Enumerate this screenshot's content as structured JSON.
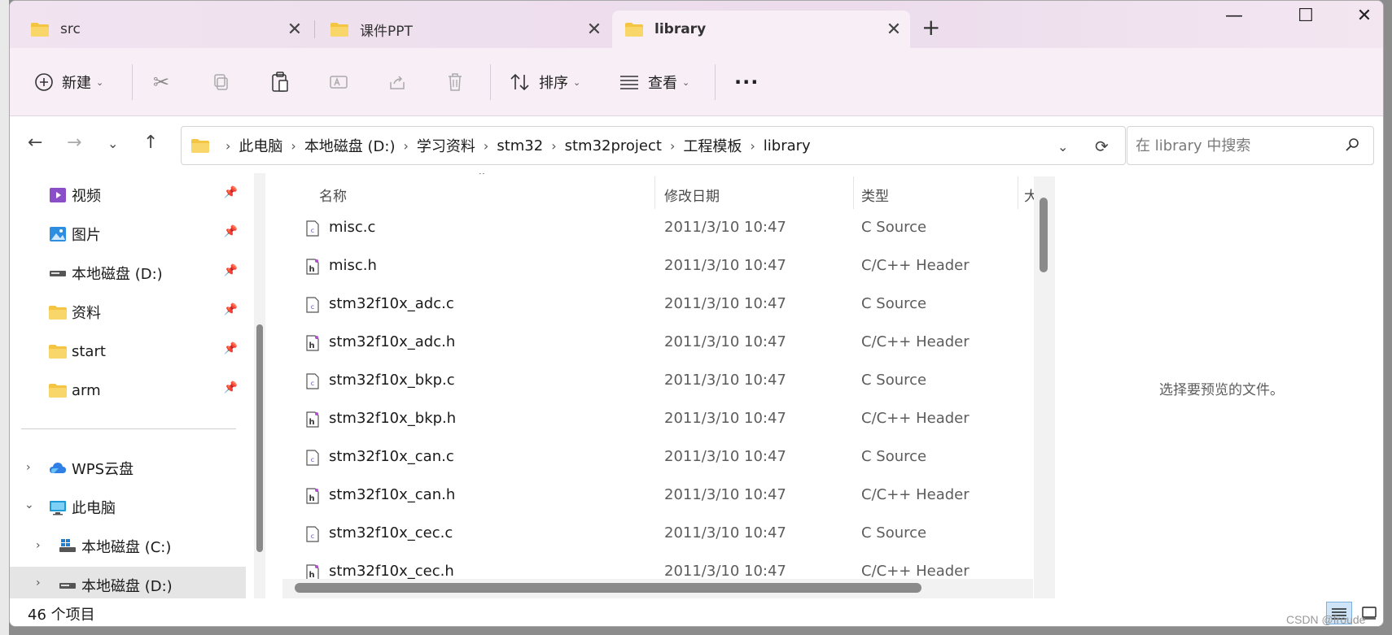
{
  "tabs": [
    {
      "label": "src"
    },
    {
      "label": "课件PPT"
    },
    {
      "label": "library"
    }
  ],
  "window": {
    "minimize_icon": "minimize-icon",
    "maximize_icon": "maximize-icon",
    "close_icon": "close-icon"
  },
  "toolbar": {
    "new_label": "新建",
    "sort_label": "排序",
    "view_label": "查看",
    "more_label": "···"
  },
  "address": {
    "crumbs": [
      "此电脑",
      "本地磁盘 (D:)",
      "学习资料",
      "stm32",
      "stm32project",
      "工程模板",
      "library"
    ]
  },
  "search": {
    "placeholder": "在 library 中搜索"
  },
  "sidebar": {
    "quick": [
      {
        "label": "视频",
        "icon": "video-folder-icon"
      },
      {
        "label": "图片",
        "icon": "pictures-folder-icon"
      },
      {
        "label": "本地磁盘 (D:)",
        "icon": "drive-icon"
      },
      {
        "label": "资料",
        "icon": "folder-icon"
      },
      {
        "label": "start",
        "icon": "folder-icon"
      },
      {
        "label": "arm",
        "icon": "folder-icon"
      }
    ],
    "tree": [
      {
        "label": "WPS云盘",
        "icon": "cloud-icon"
      },
      {
        "label": "此电脑",
        "icon": "computer-icon"
      },
      {
        "label": "本地磁盘 (C:)",
        "icon": "windows-drive-icon"
      },
      {
        "label": "本地磁盘 (D:)",
        "icon": "drive-icon"
      }
    ]
  },
  "columns": {
    "name": "名称",
    "date": "修改日期",
    "type": "类型",
    "size": "大"
  },
  "files": [
    {
      "name": "misc.c",
      "date": "2011/3/10 10:47",
      "type": "C Source",
      "kind": "c"
    },
    {
      "name": "misc.h",
      "date": "2011/3/10 10:47",
      "type": "C/C++ Header",
      "kind": "h"
    },
    {
      "name": "stm32f10x_adc.c",
      "date": "2011/3/10 10:47",
      "type": "C Source",
      "kind": "c"
    },
    {
      "name": "stm32f10x_adc.h",
      "date": "2011/3/10 10:47",
      "type": "C/C++ Header",
      "kind": "h"
    },
    {
      "name": "stm32f10x_bkp.c",
      "date": "2011/3/10 10:47",
      "type": "C Source",
      "kind": "c"
    },
    {
      "name": "stm32f10x_bkp.h",
      "date": "2011/3/10 10:47",
      "type": "C/C++ Header",
      "kind": "h"
    },
    {
      "name": "stm32f10x_can.c",
      "date": "2011/3/10 10:47",
      "type": "C Source",
      "kind": "c"
    },
    {
      "name": "stm32f10x_can.h",
      "date": "2011/3/10 10:47",
      "type": "C/C++ Header",
      "kind": "h"
    },
    {
      "name": "stm32f10x_cec.c",
      "date": "2011/3/10 10:47",
      "type": "C Source",
      "kind": "c"
    },
    {
      "name": "stm32f10x_cec.h",
      "date": "2011/3/10 10:47",
      "type": "C/C++ Header",
      "kind": "h"
    }
  ],
  "preview": {
    "text": "选择要预览的文件。"
  },
  "status": {
    "count": "46 个项目"
  },
  "watermark": "CSDN @froude"
}
